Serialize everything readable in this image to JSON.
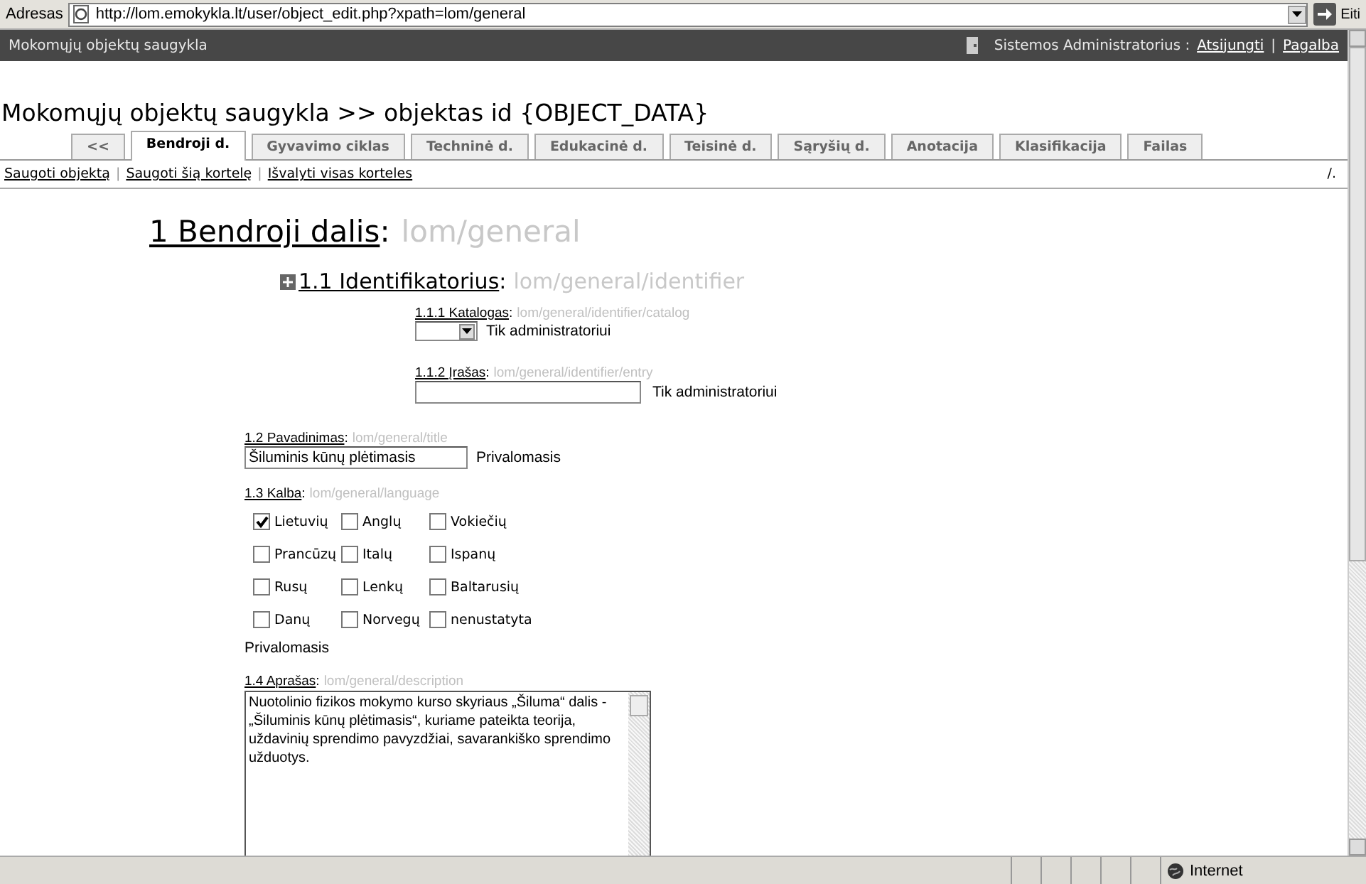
{
  "address_bar": {
    "label": "Adresas",
    "url": "http://lom.emokykla.lt/user/object_edit.php?xpath=lom/general",
    "go": "Eiti"
  },
  "header": {
    "site": "Mokomųjų objektų saugykla",
    "user": "Sistemos Administratorius :",
    "links": [
      "Atsijungti",
      "Pagalba"
    ],
    "separator": "|"
  },
  "page_title": "Mokomųjų objektų saugykla >> objektas id {OBJECT_DATA}",
  "tabs": [
    {
      "label": "<<",
      "selected": false
    },
    {
      "label": "Bendroji d.",
      "selected": true
    },
    {
      "label": "Gyvavimo ciklas",
      "selected": false
    },
    {
      "label": "Techninė d.",
      "selected": false
    },
    {
      "label": "Edukacinė d.",
      "selected": false
    },
    {
      "label": "Teisinė d.",
      "selected": false
    },
    {
      "label": "Sąryšių d.",
      "selected": false
    },
    {
      "label": "Anotacija",
      "selected": false
    },
    {
      "label": "Klasifikacija",
      "selected": false
    },
    {
      "label": "Failas",
      "selected": false
    }
  ],
  "actions": {
    "links": [
      "Saugoti objektą",
      "Saugoti šią kortelę",
      "Išvalyti visas korteles"
    ],
    "separator": "|",
    "right": "/."
  },
  "section": {
    "title": "1 Bendroji dalis",
    "colon": ":",
    "path": "lom/general"
  },
  "identifier": {
    "title": "1.1 Identifikatorius",
    "colon": ":",
    "path": "lom/general/identifier",
    "expanded": false,
    "fields": [
      {
        "kind": "select",
        "label": "1.1.1 Katalogas",
        "colon": ":",
        "path": "lom/general/identifier/catalog",
        "note": "Tik administratoriui"
      },
      {
        "kind": "text",
        "label": "1.1.2 Įrašas",
        "colon": ":",
        "path": "lom/general/identifier/entry",
        "note": "Tik administratoriui"
      }
    ]
  },
  "title_field": {
    "label": "1.2 Pavadinimas",
    "colon": ":",
    "path": "lom/general/title",
    "value": "Šiluminis kūnų plėtimasis",
    "note": "Privalomasis"
  },
  "language": {
    "label": "1.3 Kalba",
    "colon": ":",
    "path": "lom/general/language",
    "note": "Privalomasis",
    "options": [
      {
        "label": "Lietuvių",
        "checked": true
      },
      {
        "label": "Anglų",
        "checked": false
      },
      {
        "label": "Vokiečių",
        "checked": false
      },
      {
        "label": "Prancūzų",
        "checked": false
      },
      {
        "label": "Italų",
        "checked": false
      },
      {
        "label": "Ispanų",
        "checked": false
      },
      {
        "label": "Rusų",
        "checked": false
      },
      {
        "label": "Lenkų",
        "checked": false
      },
      {
        "label": "Baltarusių",
        "checked": false
      },
      {
        "label": "Danų",
        "checked": false
      },
      {
        "label": "Norvegų",
        "checked": false
      },
      {
        "label": "nenustatyta",
        "checked": false
      }
    ]
  },
  "description": {
    "label": "1.4 Aprašas",
    "colon": ":",
    "path": "lom/general/description",
    "value": "Nuotolinio fizikos mokymo kurso skyriaus „Šiluma“ dalis - „Šiluminis kūnų plėtimasis“, kuriame pateikta teorija, uždavinių sprendimo pavyzdžiai, savarankiško sprendimo užduotys."
  },
  "status_bar": {
    "zone": "Internet"
  }
}
